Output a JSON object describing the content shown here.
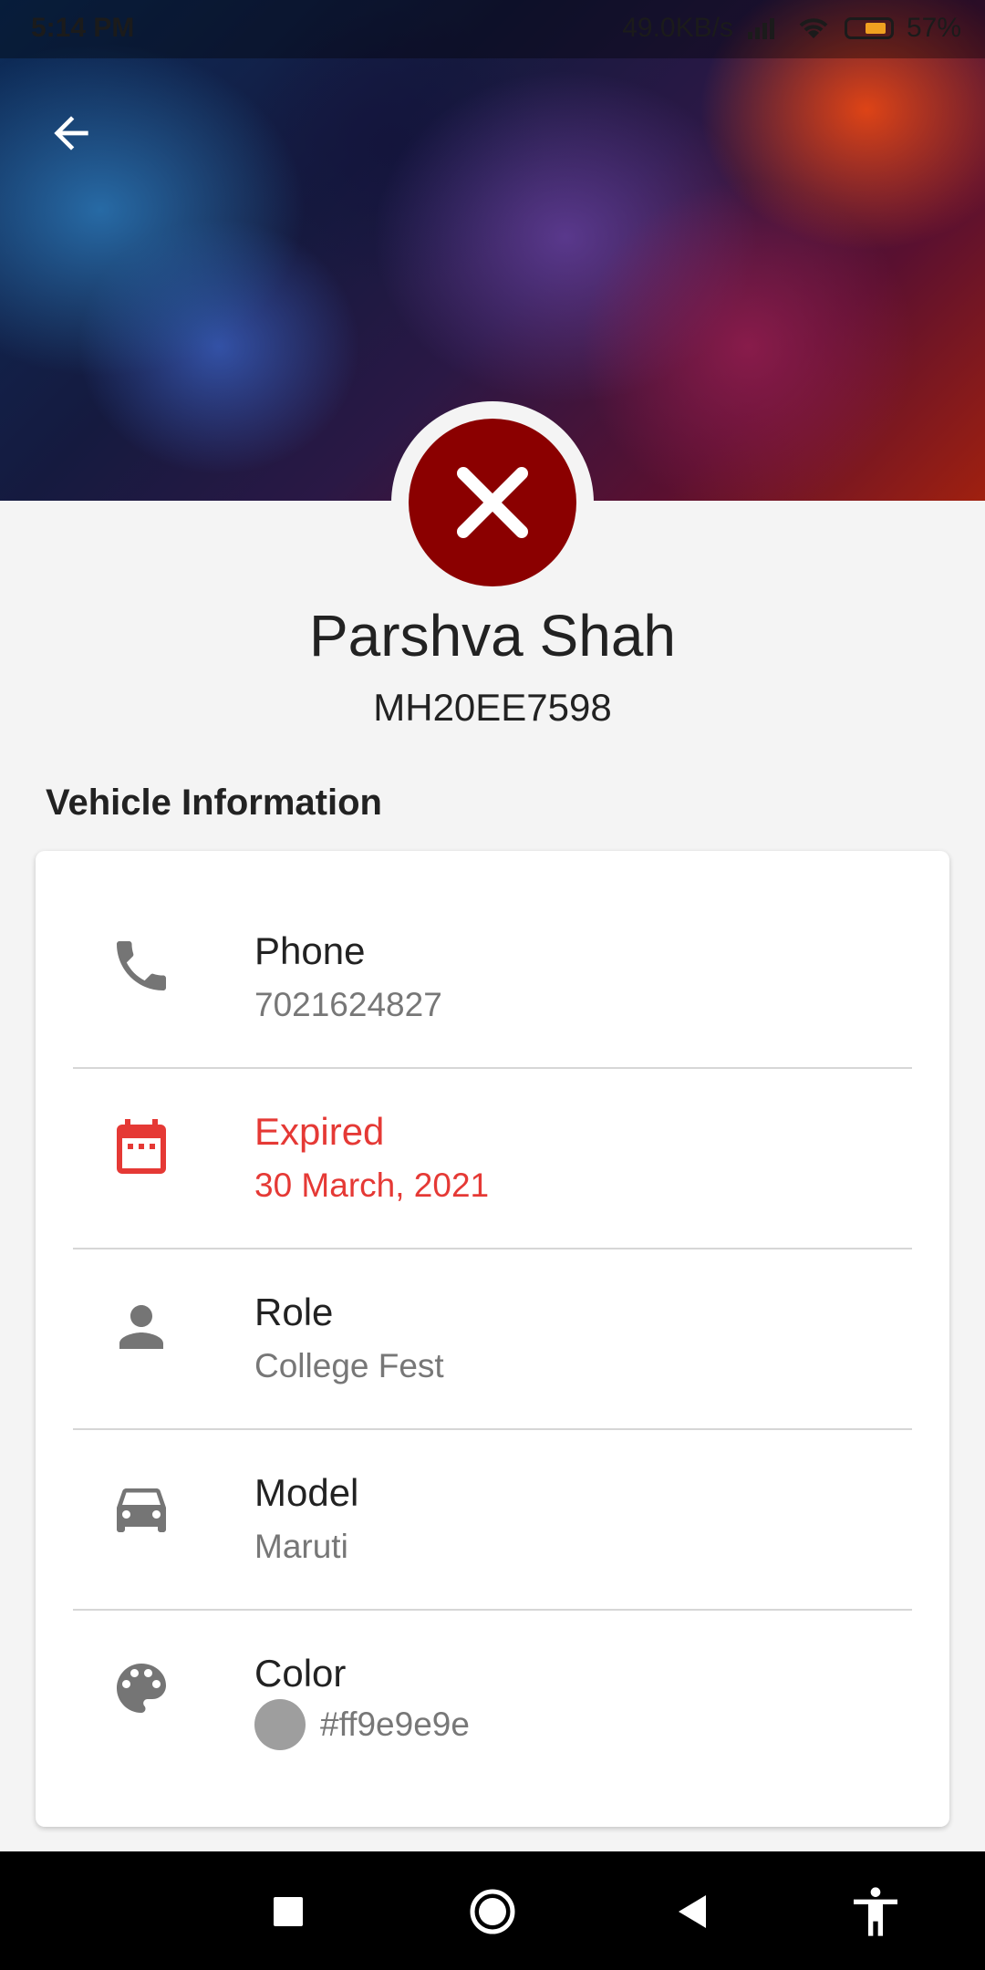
{
  "status_bar": {
    "time": "5:14 PM",
    "network_speed": "49.0KB/s",
    "battery_percent": "57%"
  },
  "profile": {
    "name": "Parshva Shah",
    "plate": "MH20EE7598",
    "status_icon": "close-icon",
    "status_color": "#8b0000"
  },
  "section": {
    "title": "Vehicle Information"
  },
  "info": {
    "phone": {
      "label": "Phone",
      "value": "7021624827",
      "icon": "phone-icon"
    },
    "expiry": {
      "label": "Expired",
      "value": "30 March, 2021",
      "icon": "calendar-icon",
      "color": "#e53935"
    },
    "role": {
      "label": "Role",
      "value": "College Fest",
      "icon": "person-icon"
    },
    "model": {
      "label": "Model",
      "value": "Maruti",
      "icon": "car-icon"
    },
    "color": {
      "label": "Color",
      "value": "#ff9e9e9e",
      "icon": "palette-icon",
      "swatch": "#9e9e9e"
    }
  },
  "navigation": {
    "icons": [
      "recents-square-icon",
      "home-circle-icon",
      "back-triangle-icon",
      "accessibility-icon"
    ]
  }
}
